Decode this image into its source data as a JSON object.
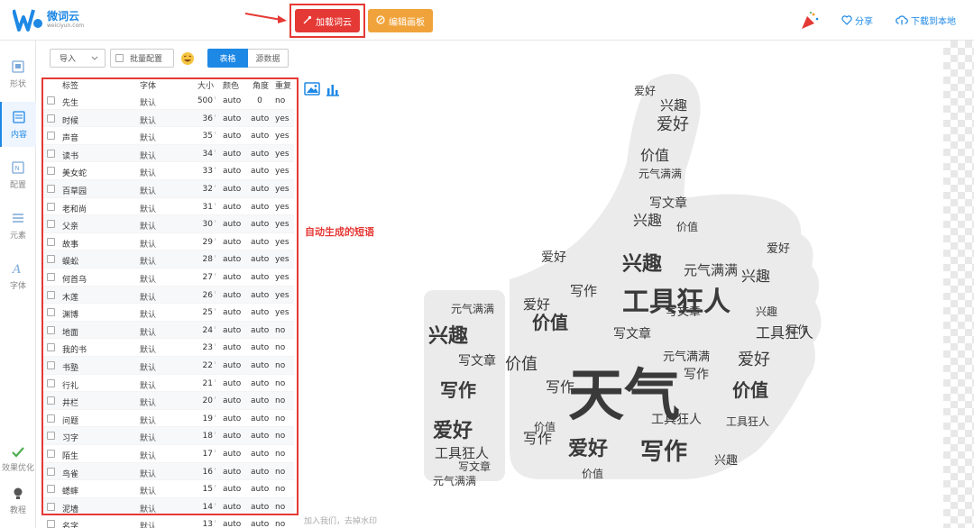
{
  "header": {
    "logo_name": "微词云",
    "logo_url": "weiciyun.com",
    "load_button": "加载词云",
    "edit_button": "编辑画板",
    "share": "分享",
    "download": "下载到本地"
  },
  "nav": {
    "items": [
      "形状",
      "内容",
      "配置",
      "元素",
      "字体"
    ],
    "bottom": [
      "效果优化",
      "教程"
    ]
  },
  "toolbar": {
    "import": "导入",
    "batch": "批量配置",
    "tab_table": "表格",
    "tab_source": "源数据"
  },
  "table": {
    "headers": [
      "标签",
      "字体",
      "大小",
      "颜色",
      "角度",
      "重复"
    ],
    "rows": [
      {
        "label": "先生",
        "font": "默认",
        "size": "500",
        "color": "auto",
        "angle": "0",
        "repeat": "no"
      },
      {
        "label": "时候",
        "font": "默认",
        "size": "36",
        "color": "auto",
        "angle": "auto",
        "repeat": "yes"
      },
      {
        "label": "声音",
        "font": "默认",
        "size": "35",
        "color": "auto",
        "angle": "auto",
        "repeat": "yes"
      },
      {
        "label": "读书",
        "font": "默认",
        "size": "34",
        "color": "auto",
        "angle": "auto",
        "repeat": "yes"
      },
      {
        "label": "美女蛇",
        "font": "默认",
        "size": "33",
        "color": "auto",
        "angle": "auto",
        "repeat": "yes"
      },
      {
        "label": "百草园",
        "font": "默认",
        "size": "32",
        "color": "auto",
        "angle": "auto",
        "repeat": "yes"
      },
      {
        "label": "老和尚",
        "font": "默认",
        "size": "31",
        "color": "auto",
        "angle": "auto",
        "repeat": "yes"
      },
      {
        "label": "父亲",
        "font": "默认",
        "size": "30",
        "color": "auto",
        "angle": "auto",
        "repeat": "yes"
      },
      {
        "label": "故事",
        "font": "默认",
        "size": "29",
        "color": "auto",
        "angle": "auto",
        "repeat": "yes"
      },
      {
        "label": "蜈蚣",
        "font": "默认",
        "size": "28",
        "color": "auto",
        "angle": "auto",
        "repeat": "yes"
      },
      {
        "label": "何首乌",
        "font": "默认",
        "size": "27",
        "color": "auto",
        "angle": "auto",
        "repeat": "yes"
      },
      {
        "label": "木莲",
        "font": "默认",
        "size": "26",
        "color": "auto",
        "angle": "auto",
        "repeat": "yes"
      },
      {
        "label": "渊博",
        "font": "默认",
        "size": "25",
        "color": "auto",
        "angle": "auto",
        "repeat": "yes"
      },
      {
        "label": "地面",
        "font": "默认",
        "size": "24",
        "color": "auto",
        "angle": "auto",
        "repeat": "no"
      },
      {
        "label": "我的书",
        "font": "默认",
        "size": "23",
        "color": "auto",
        "angle": "auto",
        "repeat": "no"
      },
      {
        "label": "书塾",
        "font": "默认",
        "size": "22",
        "color": "auto",
        "angle": "auto",
        "repeat": "no"
      },
      {
        "label": "行礼",
        "font": "默认",
        "size": "21",
        "color": "auto",
        "angle": "auto",
        "repeat": "no"
      },
      {
        "label": "井栏",
        "font": "默认",
        "size": "20",
        "color": "auto",
        "angle": "auto",
        "repeat": "no"
      },
      {
        "label": "问题",
        "font": "默认",
        "size": "19",
        "color": "auto",
        "angle": "auto",
        "repeat": "no"
      },
      {
        "label": "习字",
        "font": "默认",
        "size": "18",
        "color": "auto",
        "angle": "auto",
        "repeat": "no"
      },
      {
        "label": "陌生",
        "font": "默认",
        "size": "17",
        "color": "auto",
        "angle": "auto",
        "repeat": "no"
      },
      {
        "label": "鸟雀",
        "font": "默认",
        "size": "16",
        "color": "auto",
        "angle": "auto",
        "repeat": "no"
      },
      {
        "label": "蟋蟀",
        "font": "默认",
        "size": "15",
        "color": "auto",
        "angle": "auto",
        "repeat": "no"
      },
      {
        "label": "泥墙",
        "font": "默认",
        "size": "14",
        "color": "auto",
        "angle": "auto",
        "repeat": "no"
      },
      {
        "label": "名字",
        "font": "默认",
        "size": "13",
        "color": "auto",
        "angle": "auto",
        "repeat": "no"
      }
    ]
  },
  "annotation": "自动生成的短语",
  "footer": "加入我们，去掉水印",
  "wordcloud": {
    "words": {
      "main": "天气",
      "w1": "工具狂人",
      "w2": "兴趣",
      "w3": "爱好",
      "w4": "写作",
      "w5": "价值",
      "w6": "元气满满",
      "w7": "写文章"
    }
  },
  "colors": {
    "primary": "#1e88e5",
    "load": "#e53935",
    "edit": "#f0a33a",
    "annotation": "#e53935"
  }
}
